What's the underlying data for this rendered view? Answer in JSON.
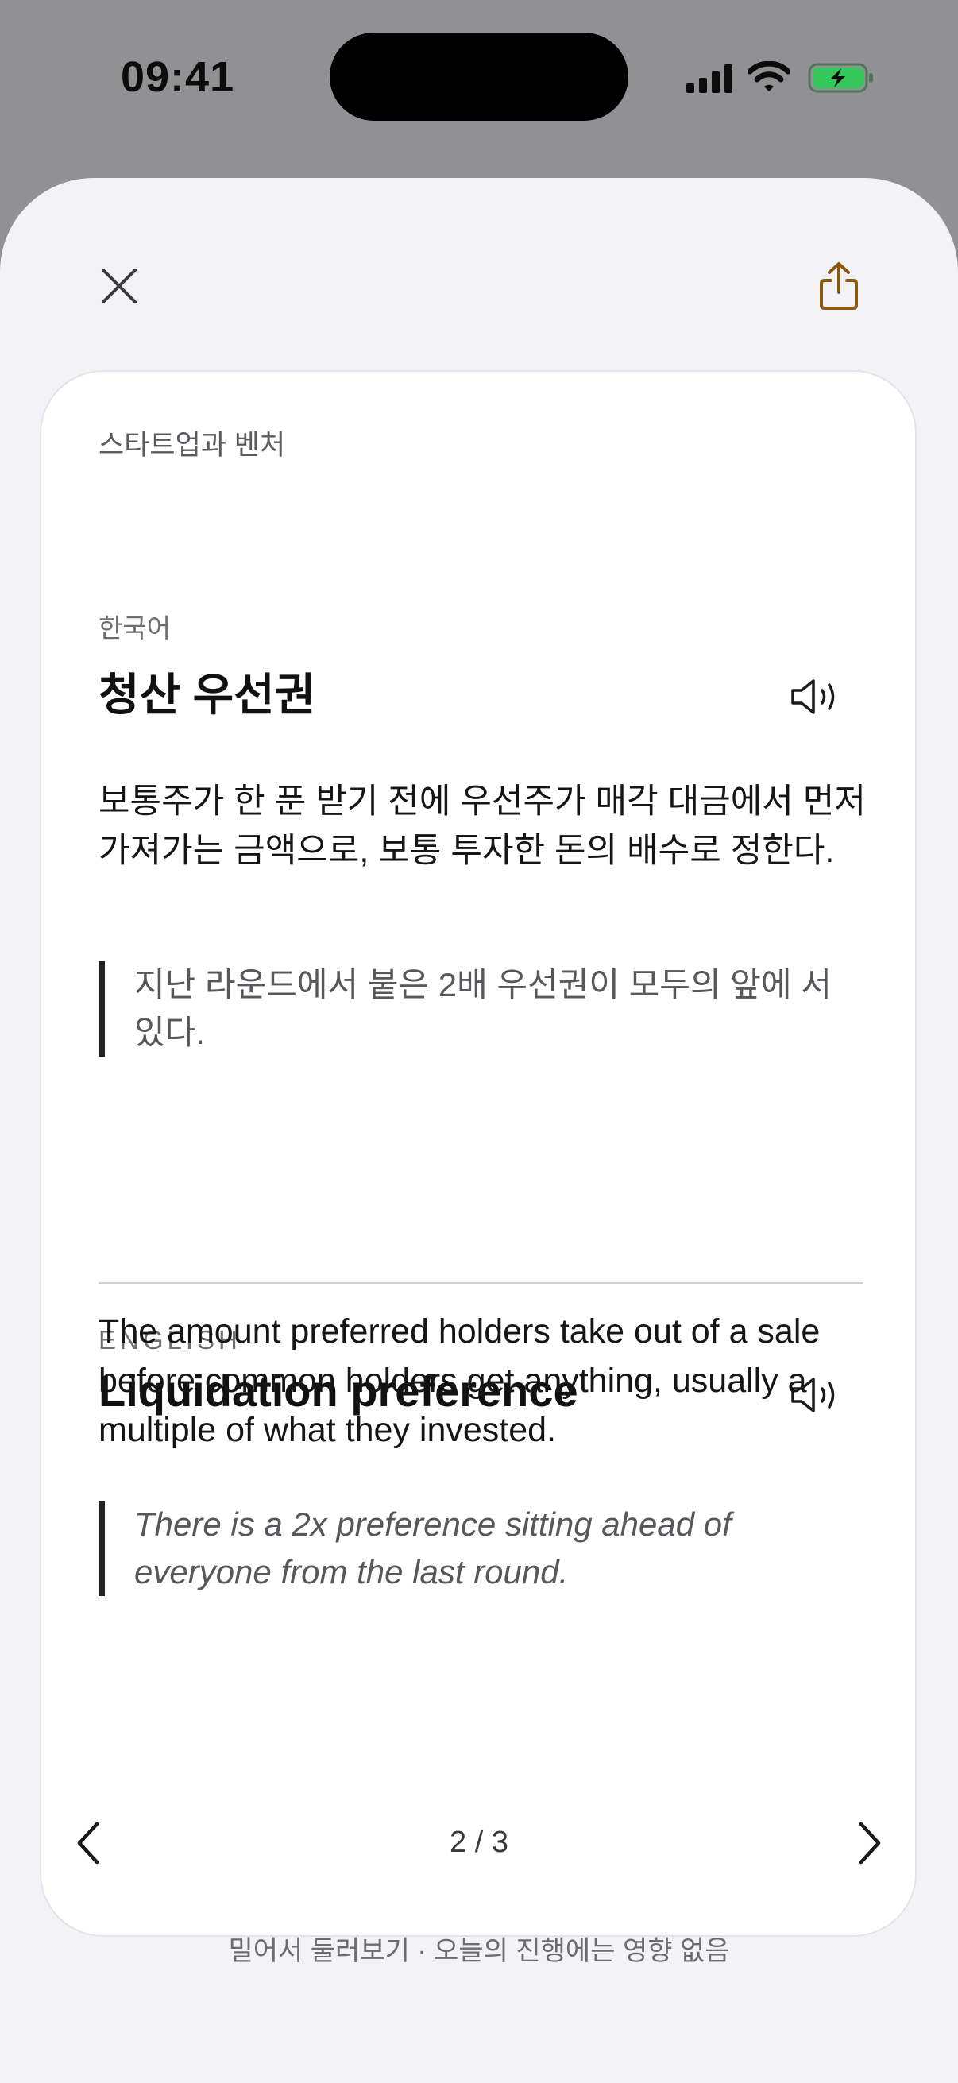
{
  "status_bar": {
    "time": "09:41",
    "icons": [
      "signal-icon",
      "wifi-icon",
      "battery-charging-icon"
    ],
    "battery_color": "#34c759"
  },
  "header": {
    "close_icon": "close-icon",
    "share_icon": "share-icon",
    "accent_color": "#8a5a12"
  },
  "card": {
    "category": "스타트업과 벤처",
    "korean": {
      "label": "한국어",
      "term": "청산 우선권",
      "definition": "보통주가 한 푼 받기 전에 우선주가 매각 대금에서 먼저 가져가는 금액으로, 보통 투자한 돈의 배수로 정한다.",
      "example": "지난 라운드에서 붙은 2배 우선권이 모두의 앞에 서 있다.",
      "speaker_icon": "speaker-icon"
    },
    "english": {
      "label": "ENGLISH",
      "term": "Liquidation preference",
      "definition": "The amount preferred holders take out of a sale before common holders get anything, usually a multiple of what they invested.",
      "example": "There is a 2x preference sitting ahead of everyone from the last round.",
      "speaker_icon": "speaker-icon"
    }
  },
  "pager": {
    "current": 2,
    "total": 3,
    "indicator": "2 / 3",
    "prev_icon": "chevron-left-icon",
    "next_icon": "chevron-right-icon"
  },
  "hint": "밀어서 둘러보기 · 오늘의 진행에는 영향 없음"
}
